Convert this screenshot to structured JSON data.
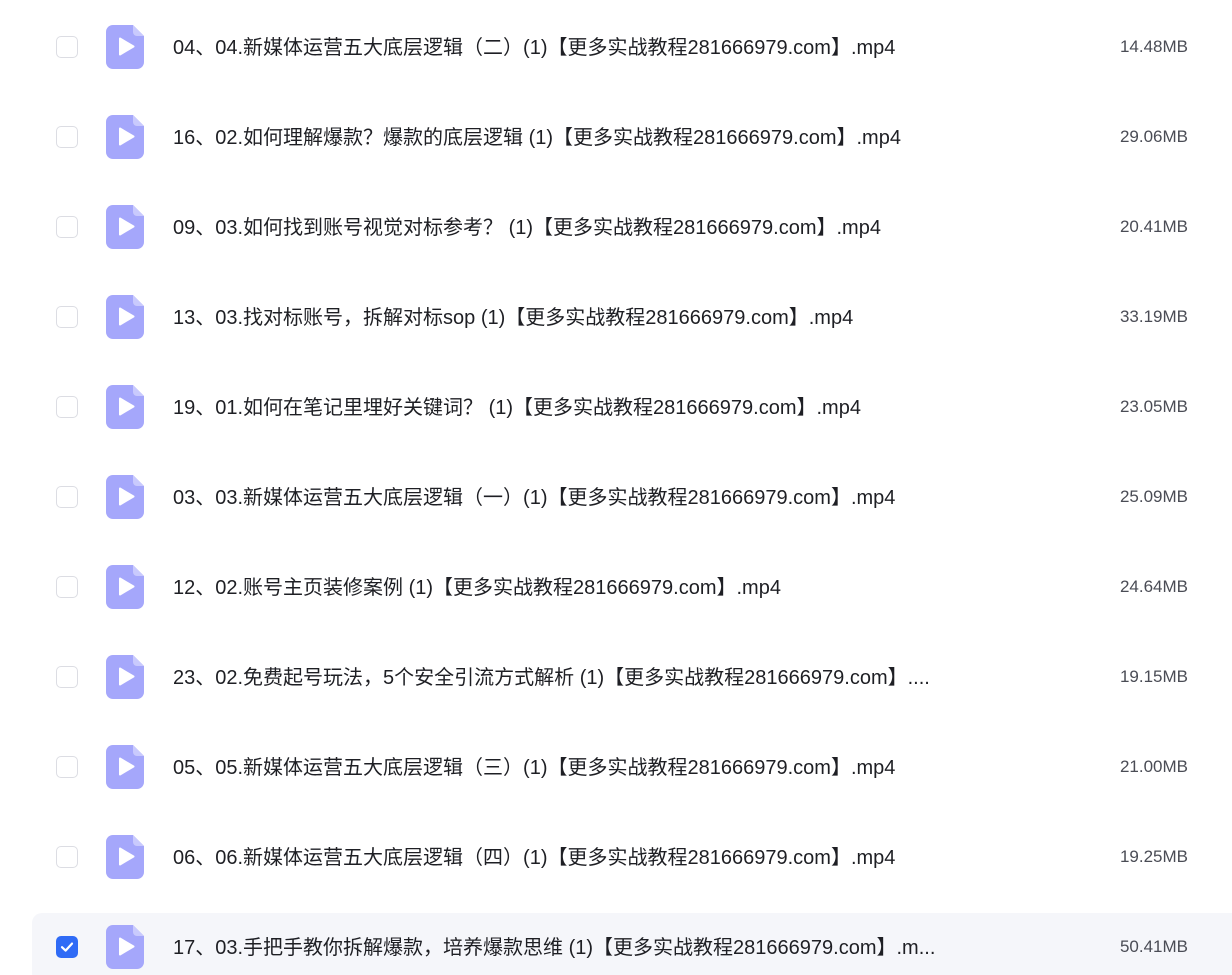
{
  "colors": {
    "icon_fill": "#a5a7fb",
    "checkbox_checked": "#2f6bf6",
    "selected_row_bg": "#f5f6fa"
  },
  "files": [
    {
      "name": "04、04.新媒体运营五大底层逻辑（二）(1)【更多实战教程281666979.com】.mp4",
      "size": "14.48MB",
      "checked": false,
      "icon": "video-file-icon"
    },
    {
      "name": "16、02.如何理解爆款？爆款的底层逻辑 (1)【更多实战教程281666979.com】.mp4",
      "size": "29.06MB",
      "checked": false,
      "icon": "video-file-icon"
    },
    {
      "name": "09、03.如何找到账号视觉对标参考？ (1)【更多实战教程281666979.com】.mp4",
      "size": "20.41MB",
      "checked": false,
      "icon": "video-file-icon"
    },
    {
      "name": "13、03.找对标账号，拆解对标sop (1)【更多实战教程281666979.com】.mp4",
      "size": "33.19MB",
      "checked": false,
      "icon": "video-file-icon"
    },
    {
      "name": "19、01.如何在笔记里埋好关键词？ (1)【更多实战教程281666979.com】.mp4",
      "size": "23.05MB",
      "checked": false,
      "icon": "video-file-icon"
    },
    {
      "name": "03、03.新媒体运营五大底层逻辑（一）(1)【更多实战教程281666979.com】.mp4",
      "size": "25.09MB",
      "checked": false,
      "icon": "video-file-icon"
    },
    {
      "name": "12、02.账号主页装修案例 (1)【更多实战教程281666979.com】.mp4",
      "size": "24.64MB",
      "checked": false,
      "icon": "video-file-icon"
    },
    {
      "name": "23、02.免费起号玩法，5个安全引流方式解析 (1)【更多实战教程281666979.com】....",
      "size": "19.15MB",
      "checked": false,
      "icon": "video-file-icon"
    },
    {
      "name": "05、05.新媒体运营五大底层逻辑（三）(1)【更多实战教程281666979.com】.mp4",
      "size": "21.00MB",
      "checked": false,
      "icon": "video-file-icon"
    },
    {
      "name": "06、06.新媒体运营五大底层逻辑（四）(1)【更多实战教程281666979.com】.mp4",
      "size": "19.25MB",
      "checked": false,
      "icon": "video-file-icon"
    },
    {
      "name": "17、03.手把手教你拆解爆款，培养爆款思维 (1)【更多实战教程281666979.com】.m...",
      "size": "50.41MB",
      "checked": true,
      "icon": "video-file-icon"
    }
  ]
}
